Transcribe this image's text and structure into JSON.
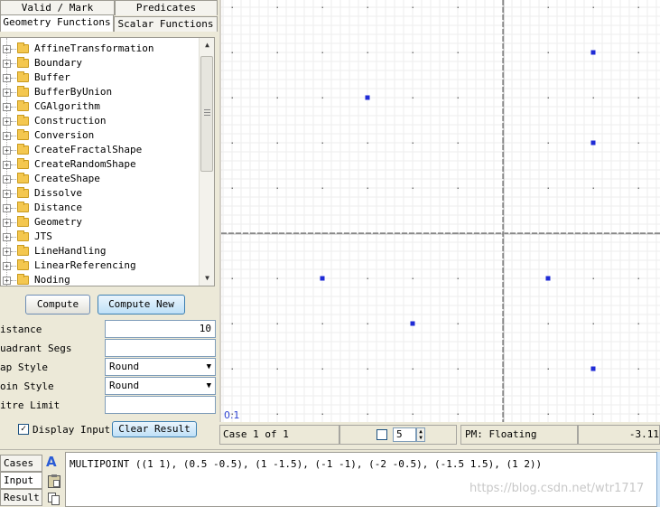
{
  "tabs": {
    "valid_mark": "Valid / Mark",
    "predicates": "Predicates",
    "geometry_functions": "Geometry Functions",
    "scalar_functions": "Scalar Functions"
  },
  "tree": {
    "expander": "+",
    "items": [
      "AffineTransformation",
      "Boundary",
      "Buffer",
      "BufferByUnion",
      "CGAlgorithm",
      "Construction",
      "Conversion",
      "CreateFractalShape",
      "CreateRandomShape",
      "CreateShape",
      "Dissolve",
      "Distance",
      "Geometry",
      "JTS",
      "LineHandling",
      "LinearReferencing",
      "Noding"
    ]
  },
  "buttons": {
    "compute": "Compute",
    "compute_new": "Compute New",
    "clear_result": "Clear Result"
  },
  "params": {
    "distance_label": "istance",
    "distance_value": "10",
    "quadrant_segs_label": "uadrant Segs",
    "quadrant_segs_value": "",
    "cap_style_label": "ap Style",
    "cap_style_value": "Round",
    "join_style_label": "oin Style",
    "join_style_value": "Round",
    "mitre_limit_label": "itre Limit",
    "mitre_limit_value": ""
  },
  "display_input": {
    "label": "Display Input",
    "checked": true,
    "check_glyph": "✓"
  },
  "map": {
    "scale_label": "0.1",
    "point_color": "#1f2bd6",
    "points": [
      [
        1,
        1
      ],
      [
        0.5,
        -0.5
      ],
      [
        1,
        -1.5
      ],
      [
        -1,
        -1
      ],
      [
        -2,
        -0.5
      ],
      [
        -1.5,
        1.5
      ],
      [
        1,
        2
      ]
    ]
  },
  "status": {
    "case": "Case 1 of 1",
    "spinner_value": "5",
    "pm": "PM: Floating",
    "coord": "-3.11"
  },
  "bottom": {
    "cases_tab": "Cases",
    "input_tab": "Input",
    "result_tab": "Result",
    "geom_a_label": "A",
    "wkt": "MULTIPOINT ((1 1), (0.5 -0.5), (1 -1.5), (-1 -1), (-2 -0.5), (-1.5 1.5), (1 2))",
    "watermark": "https://blog.csdn.net/wtr1717"
  }
}
